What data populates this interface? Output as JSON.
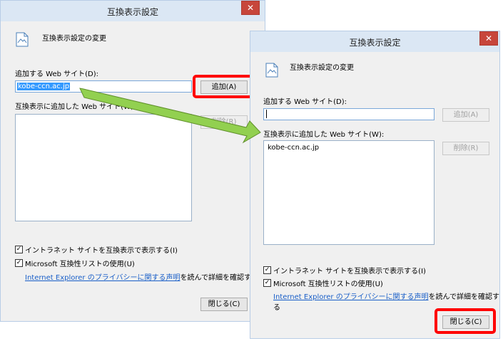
{
  "colors": {
    "highlight": "#ff0000",
    "arrow": "#92d050",
    "close": "#c7463b",
    "link": "#1a5fc8"
  },
  "dialog_before": {
    "title": "互換表示設定",
    "close_glyph": "✕",
    "heading": "互換表示設定の変更",
    "add_site_label": "追加する Web サイト(D):",
    "add_site_value": "kobe-ccn.ac.jp",
    "add_button": "追加(A)",
    "list_label": "互換表示に追加した Web サイト(W):",
    "remove_button": "削除(R)",
    "checkbox_intranet": "イントラネット サイトを互換表示で表示する(I)",
    "checkbox_microsoft": "Microsoft 互換性リストの使用(U)",
    "privacy_link": "Internet Explorer のプライバシーに関する声明",
    "privacy_suffix": "を読んで詳細を確認する",
    "close_button": "閉じる(C)"
  },
  "dialog_after": {
    "title": "互換表示設定",
    "close_glyph": "✕",
    "heading": "互換表示設定の変更",
    "add_site_label": "追加する Web サイト(D):",
    "add_site_value": "",
    "add_button": "追加(A)",
    "list_label": "互換表示に追加した Web サイト(W):",
    "list_items": [
      "kobe-ccn.ac.jp"
    ],
    "remove_button": "削除(R)",
    "checkbox_intranet": "イントラネット サイトを互換表示で表示する(I)",
    "checkbox_microsoft": "Microsoft 互換性リストの使用(U)",
    "privacy_link": "Internet Explorer のプライバシーに関する声明",
    "privacy_suffix": "を読んで詳細を確認する",
    "close_button": "閉じる(C)"
  }
}
